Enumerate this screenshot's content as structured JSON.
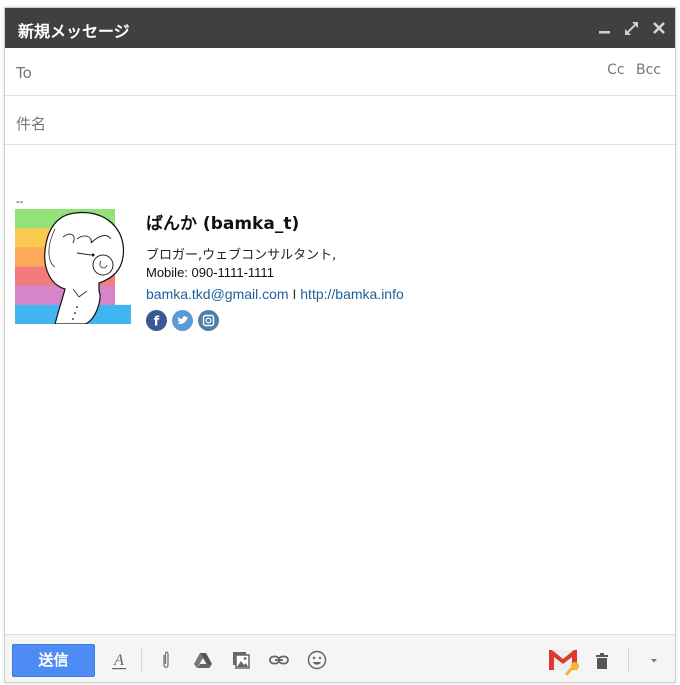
{
  "window": {
    "title": "新規メッセージ",
    "controls": {
      "minimize": "minimize-icon",
      "fullscreen": "expand-icon",
      "close": "close-icon"
    }
  },
  "fields": {
    "to_label": "To",
    "cc_label": "Cc",
    "bcc_label": "Bcc",
    "subject_placeholder": "件名"
  },
  "signature": {
    "separator": "--",
    "name": "ばんか (bamka_t)",
    "title": "ブロガー,ウェブコンサルタント,",
    "mobile": "Mobile: 090-1111-1111",
    "email": "bamka.tkd@gmail.com",
    "link_separator": "I",
    "website": "http://bamka.info",
    "avatar_stripes": [
      "#92e27a",
      "#f9ca4f",
      "#fcaa58",
      "#f27b7b",
      "#d685c9",
      "#3fb6ef"
    ],
    "social": [
      {
        "name": "facebook",
        "glyph": "f",
        "color": "#3b5998"
      },
      {
        "name": "twitter",
        "glyph": "t",
        "color": "#5b9bd5"
      },
      {
        "name": "instagram",
        "glyph": "ig",
        "color": "#517fa4"
      }
    ]
  },
  "toolbar": {
    "send_label": "送信",
    "send_color": "#4d8bf5",
    "tools": [
      "formatting-icon",
      "attach-icon",
      "drive-icon",
      "insert-photo-icon",
      "link-icon",
      "emoji-icon"
    ],
    "right_tools": [
      "gmail-encrypt-icon",
      "trash-icon",
      "more-options-icon"
    ]
  }
}
